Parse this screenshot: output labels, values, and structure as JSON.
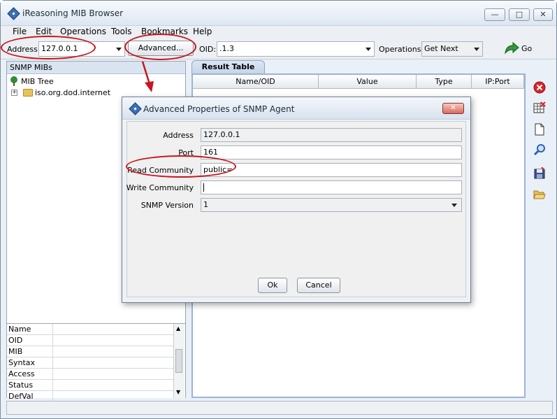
{
  "window": {
    "title": "iReasoning MIB Browser",
    "controls": {
      "minimize": "—",
      "maximize": "□",
      "close": "✕"
    }
  },
  "menu": [
    "File",
    "Edit",
    "Operations",
    "Tools",
    "Bookmarks",
    "Help"
  ],
  "toolbar": {
    "address_label": "Address:",
    "address_value": "127.0.0.1",
    "advanced_button": "Advanced...",
    "oid_label": "OID:",
    "oid_value": ".1.3",
    "operations_label": "Operations:",
    "operations_value": "Get Next",
    "go_button": "Go"
  },
  "left_panel": {
    "header": "SNMP MIBs",
    "tree_root": "MIB Tree",
    "tree_child": "iso.org.dod.internet",
    "properties": [
      "Name",
      "OID",
      "MIB",
      "Syntax",
      "Access",
      "Status",
      "DefVal"
    ]
  },
  "result": {
    "tab_label": "Result Table",
    "columns": [
      "Name/OID",
      "Value",
      "Type",
      "IP:Port"
    ]
  },
  "dialog": {
    "title": "Advanced Properties of SNMP Agent",
    "close": "✕",
    "fields": {
      "address_label": "Address",
      "address_value": "127.0.0.1",
      "port_label": "Port",
      "port_value": "161",
      "read_label": "Read Community",
      "read_value": "public=",
      "write_label": "Write Community",
      "write_value": "",
      "version_label": "SNMP Version",
      "version_value": "1"
    },
    "ok_button": "Ok",
    "cancel_button": "Cancel"
  },
  "colors": {
    "annotation": "#c8161d",
    "accent": "#3d6fb6"
  },
  "side_tools": [
    "stop-icon",
    "table-delete-icon",
    "new-document-icon",
    "find-icon",
    "save-icon",
    "open-folder-icon"
  ]
}
